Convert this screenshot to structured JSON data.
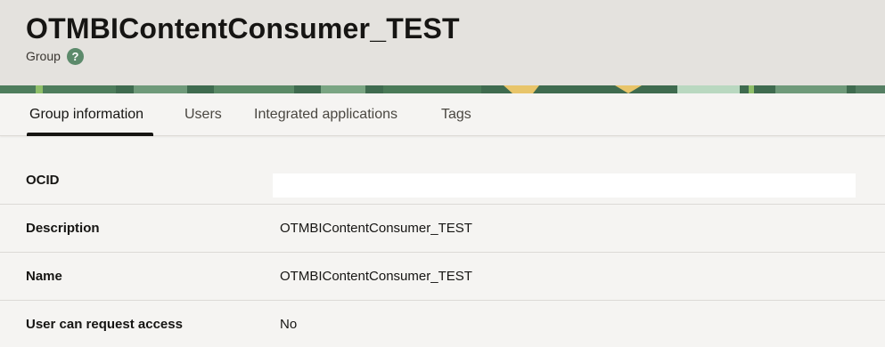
{
  "header": {
    "title": "OTMBIContentConsumer_TEST",
    "subtitle": "Group",
    "help_icon": "question-mark-icon",
    "help_glyph": "?",
    "accent_color": "#5c8a6b"
  },
  "tabs": [
    {
      "label": "Group information",
      "active": true
    },
    {
      "label": "Users",
      "active": false
    },
    {
      "label": "Integrated applications",
      "active": false
    },
    {
      "label": "Tags",
      "active": false
    }
  ],
  "details": {
    "ocid": {
      "label": "OCID",
      "value": ""
    },
    "description": {
      "label": "Description",
      "value": "OTMBIContentConsumer_TEST"
    },
    "name": {
      "label": "Name",
      "value": "OTMBIContentConsumer_TEST"
    },
    "user_can_request_access": {
      "label": "User can request access",
      "value": "No"
    }
  }
}
